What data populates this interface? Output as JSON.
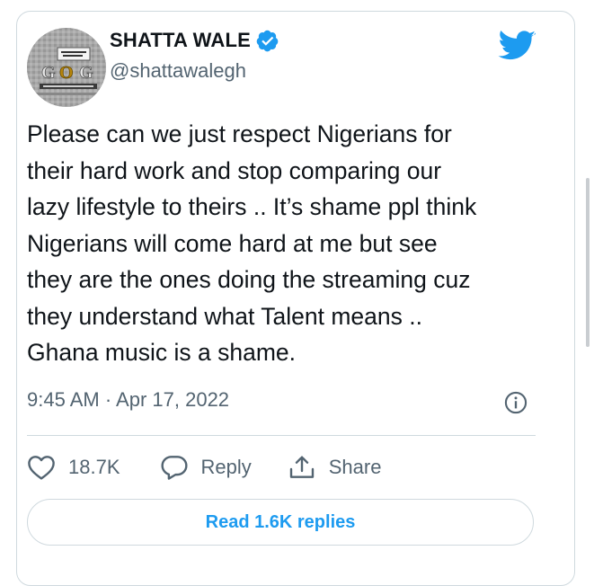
{
  "tweet": {
    "author": {
      "display_name": "SHATTA WALE",
      "handle": "@shattawalegh",
      "verified": true,
      "avatar_icon": "profile-avatar-image"
    },
    "text": "Please can we just respect Nigerians for\ntheir hard work and stop comparing our\nlazy lifestyle to theirs .. It’s shame ppl think\nNigerians will come hard at me but see\nthey are the ones doing the streaming cuz\nthey understand what Talent means ..\nGhana music is a shame.",
    "timestamp": "9:45 AM · Apr 17, 2022",
    "actions": {
      "like_count": "18.7K",
      "reply_label": "Reply",
      "share_label": "Share"
    },
    "read_replies_label": "Read 1.6K replies"
  },
  "colors": {
    "accent": "#1d9bf0",
    "text_primary": "#0f1419",
    "text_secondary": "#536471",
    "border": "#cfd9de"
  },
  "icons": {
    "verified": "verified-badge-icon",
    "brand": "twitter-bird-icon",
    "info": "info-icon",
    "like": "heart-icon",
    "reply": "speech-bubble-icon",
    "share": "share-upload-icon"
  }
}
